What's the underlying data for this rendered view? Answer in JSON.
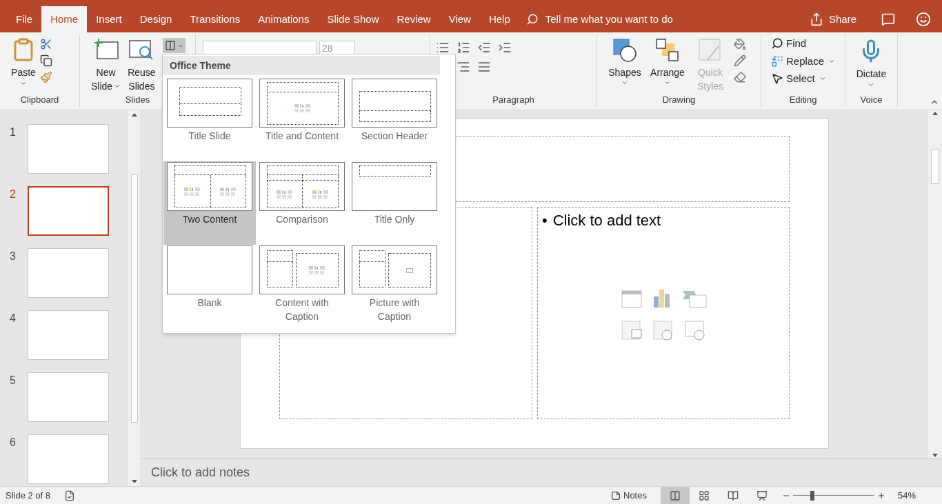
{
  "tabs": [
    {
      "label": "File",
      "selected": false
    },
    {
      "label": "Home",
      "selected": true
    },
    {
      "label": "Insert",
      "selected": false
    },
    {
      "label": "Design",
      "selected": false
    },
    {
      "label": "Transitions",
      "selected": false
    },
    {
      "label": "Animations",
      "selected": false
    },
    {
      "label": "Slide Show",
      "selected": false
    },
    {
      "label": "Review",
      "selected": false
    },
    {
      "label": "View",
      "selected": false
    },
    {
      "label": "Help",
      "selected": false
    }
  ],
  "tell_me": {
    "placeholder": "Tell me what you want to do"
  },
  "share": "Share",
  "ribbon": {
    "clipboard": {
      "label": "Clipboard",
      "paste": "Paste"
    },
    "slides": {
      "label": "Slides",
      "new_slide": [
        "New",
        "Slide"
      ],
      "reuse_slides": [
        "Reuse",
        "Slides"
      ]
    },
    "font": {
      "size": "28"
    },
    "paragraph": {
      "label": "Paragraph"
    },
    "drawing": {
      "label": "Drawing",
      "items": [
        {
          "label": "Shapes",
          "disabled": false
        },
        {
          "label": "Arrange",
          "disabled": false
        },
        {
          "label": "Quick Styles",
          "disabled": true
        }
      ]
    },
    "editing": {
      "label": "Editing",
      "find": "Find",
      "replace": "Replace",
      "select": "Select"
    },
    "voice": {
      "label": "Voice",
      "dictate": "Dictate"
    }
  },
  "layout_menu": {
    "header": "Office Theme",
    "layouts": [
      {
        "kind": "title",
        "name": "Title Slide",
        "selected": false
      },
      {
        "kind": "title-content",
        "name": "Title and Content",
        "selected": false
      },
      {
        "kind": "section",
        "name": "Section Header",
        "selected": false
      },
      {
        "kind": "two-content",
        "name": "Two Content",
        "selected": true
      },
      {
        "kind": "comparison",
        "name": "Comparison",
        "selected": false
      },
      {
        "kind": "title-only",
        "name": "Title Only",
        "selected": false
      },
      {
        "kind": "blank",
        "name": "Blank",
        "selected": false
      },
      {
        "kind": "content-caption",
        "name": "Content with Caption",
        "selected": false
      },
      {
        "kind": "picture-caption",
        "name": "Picture with Caption",
        "selected": false
      }
    ]
  },
  "thumbnails": [
    {
      "number": "1",
      "selected": false
    },
    {
      "number": "2",
      "selected": true
    },
    {
      "number": "3",
      "selected": false
    },
    {
      "number": "4",
      "selected": false
    },
    {
      "number": "5",
      "selected": false
    },
    {
      "number": "6",
      "selected": false
    }
  ],
  "slide": {
    "bullet": "•",
    "content_right": "Click to add text"
  },
  "notes": {
    "placeholder": "Click to add notes"
  },
  "status_bar": {
    "slide_info": "Slide 2 of 8",
    "notes": "Notes",
    "views": [
      {
        "kind": "normal",
        "selected": true
      },
      {
        "kind": "sorter",
        "selected": false
      },
      {
        "kind": "reading",
        "selected": false
      },
      {
        "kind": "show",
        "selected": false
      }
    ],
    "zoom": {
      "level": 0.24,
      "reading": "54%"
    }
  }
}
